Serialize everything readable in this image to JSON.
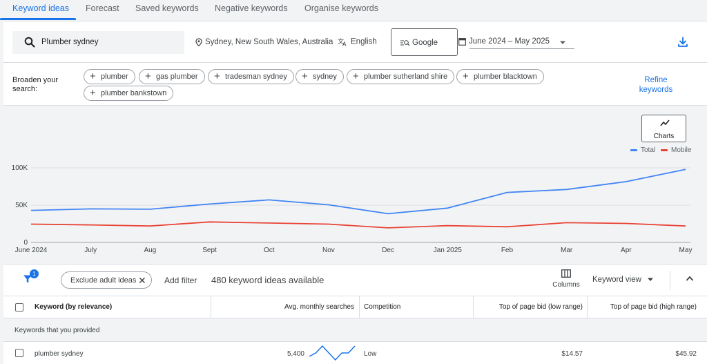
{
  "tabs": [
    {
      "label": "Keyword ideas",
      "active": true
    },
    {
      "label": "Forecast"
    },
    {
      "label": "Saved keywords"
    },
    {
      "label": "Negative keywords"
    },
    {
      "label": "Organise keywords"
    }
  ],
  "search": {
    "query": "Plumber sydney",
    "location": "Sydney, New South Wales, Australia",
    "language": "English",
    "engine": "Google",
    "date_range": "June 2024 – May 2025"
  },
  "broaden": {
    "label": "Broaden your search:",
    "chips": [
      "plumber",
      "gas plumber",
      "tradesman sydney",
      "sydney",
      "plumber sutherland shire",
      "plumber blacktown",
      "plumber bankstown"
    ],
    "refine_label": "Refine keywords"
  },
  "charts_button": "Charts",
  "chart_data": {
    "type": "line",
    "x": [
      "June 2024",
      "July",
      "Aug",
      "Sept",
      "Oct",
      "Nov",
      "Dec",
      "Jan 2025",
      "Feb",
      "Mar",
      "Apr",
      "May"
    ],
    "y_ticks": [
      "0",
      "50K",
      "100K"
    ],
    "ylim": [
      0,
      100000
    ],
    "series": [
      {
        "name": "Total",
        "color": "#4285f4",
        "values": [
          43000,
          45000,
          44500,
          51500,
          57000,
          50500,
          38500,
          46000,
          67000,
          71000,
          81500,
          98000
        ]
      },
      {
        "name": "Mobile",
        "color": "#ea4335",
        "values": [
          24500,
          23500,
          22000,
          27500,
          26000,
          24500,
          19500,
          22500,
          21000,
          26500,
          25500,
          22000
        ]
      }
    ],
    "grid": true,
    "legend": "top-right"
  },
  "filters": {
    "badge_count": "1",
    "exclude_chip": "Exclude adult ideas",
    "add_filter": "Add filter",
    "ideas_count": "480 keyword ideas available",
    "columns_label": "Columns",
    "view_label": "Keyword view"
  },
  "table": {
    "headers": [
      "Keyword (by relevance)",
      "Avg. monthly searches",
      "Competition",
      "Top of page bid (low range)",
      "Top of page bid (high range)"
    ],
    "group_label": "Keywords that you provided",
    "rows": [
      {
        "keyword": "plumber sydney",
        "searches": "5,400",
        "trend": [
          2,
          3,
          5,
          3,
          1,
          3,
          3,
          5
        ],
        "competition": "Low",
        "bid_low": "$14.57",
        "bid_high": "$45.92"
      }
    ]
  },
  "colors": {
    "accent": "#1a73e8",
    "total": "#4285f4",
    "mobile": "#ea4335"
  }
}
